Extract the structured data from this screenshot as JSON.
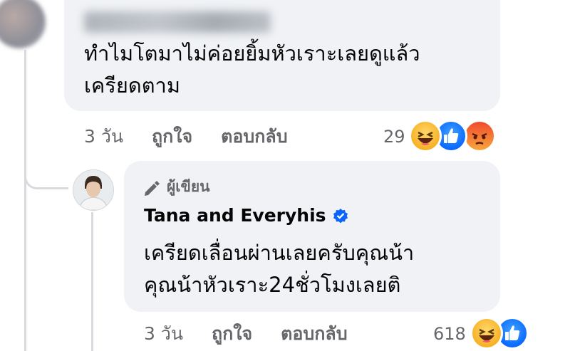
{
  "comment1": {
    "text_line1": "ทำไมโตมาไม่ค่อยยิ้มหัวเราะเลยดูแล้ว",
    "text_line2": "เครียดตาม",
    "time": "3 วัน",
    "like_label": "ถูกใจ",
    "reply_label": "ตอบกลับ",
    "reaction_count": "29",
    "reactions": [
      "haha-icon",
      "like-icon",
      "angry-icon"
    ]
  },
  "reply1": {
    "badge_label": "ผู้เขียน",
    "author_name": "Tana and Everyhis",
    "text_line1": "เครียดเลื่อนผ่านเลยครับคุณน้า",
    "text_line2": "คุณน้าหัวเราะ24ชั่วโมงเลยติ",
    "time": "3 วัน",
    "like_label": "ถูกใจ",
    "reply_label": "ตอบกลับ",
    "reaction_count": "618",
    "reactions": [
      "haha-icon",
      "like-icon"
    ]
  },
  "colors": {
    "bubble": "#f0f2f5",
    "meta_text": "#65676b",
    "verified": "#0866ff",
    "thread_line": "#d8dade"
  }
}
